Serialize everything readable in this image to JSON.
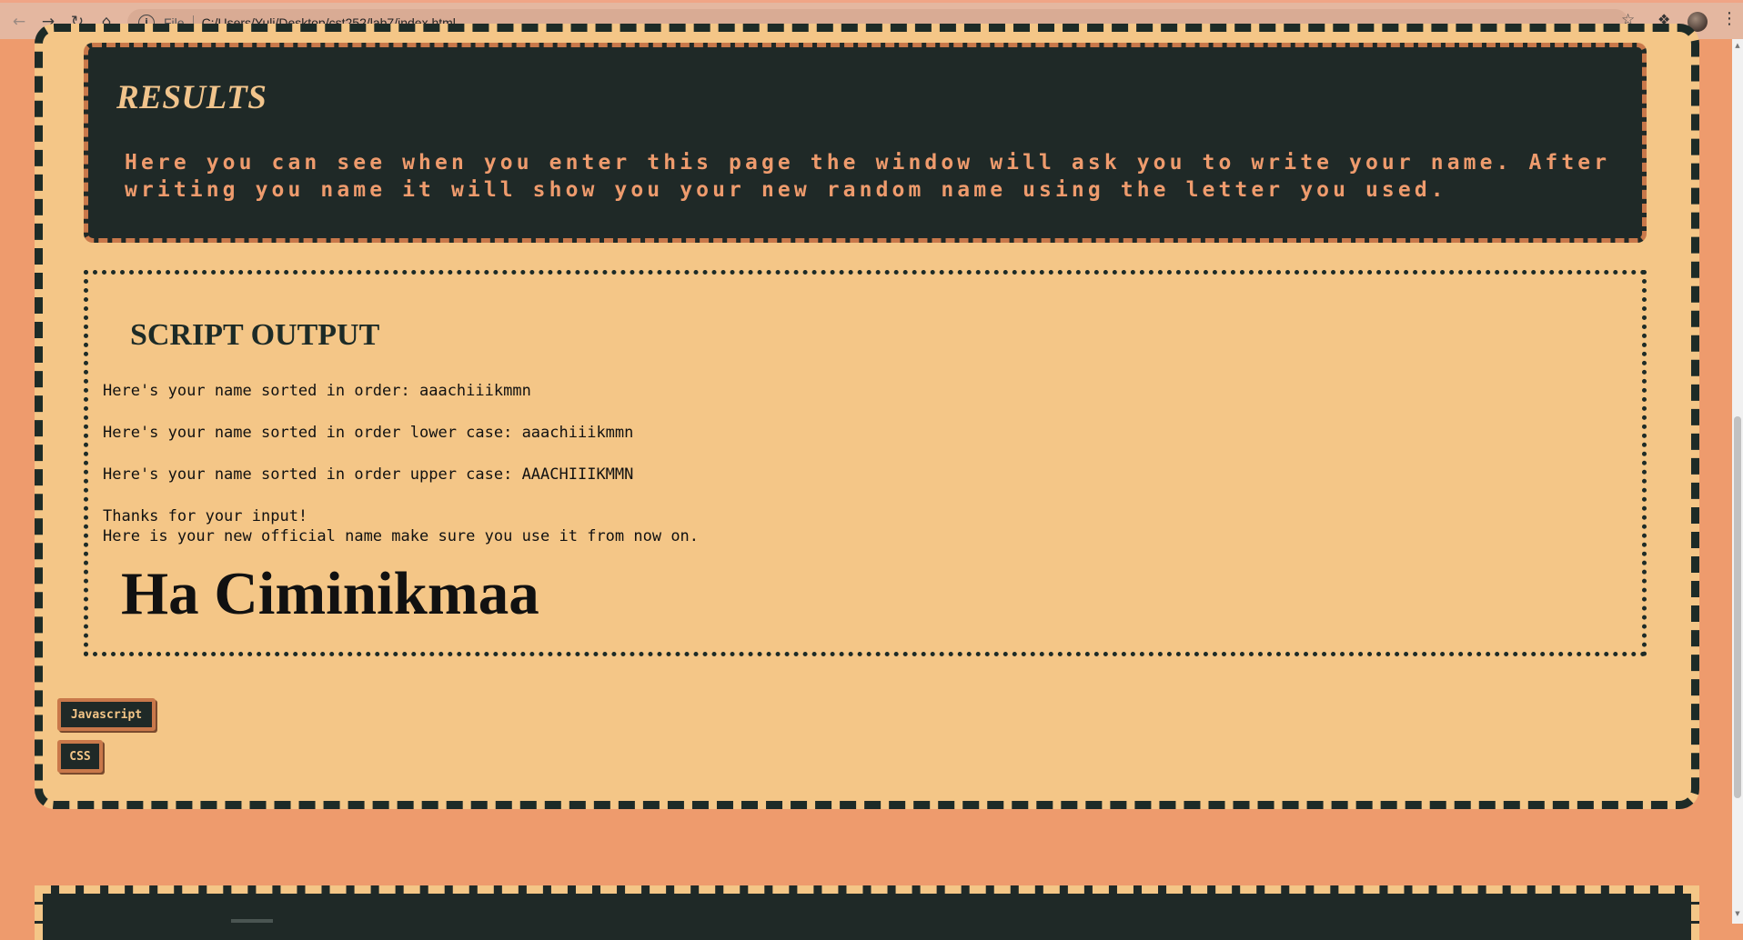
{
  "browser": {
    "scheme_label": "File",
    "url": "C:/Users/Yuli/Desktop/cst252/lab7/index.html",
    "icons": {
      "back": "back-arrow-icon",
      "forward": "forward-arrow-icon",
      "reload": "reload-icon",
      "home": "home-icon",
      "info": "info-icon",
      "bookmark": "star-icon",
      "extensions": "puzzle-icon",
      "profile": "avatar",
      "menu": "kebab-menu-icon"
    }
  },
  "results": {
    "title": "RESULTS",
    "description": "Here you can see when you enter this page the window will ask you to write your name. After writing you name it will show you your new random name using the letter you used."
  },
  "script_output": {
    "title": "SCRIPT OUTPUT",
    "sorted": "Here's your name sorted in order: aaachiiikmmn",
    "sorted_lower": "Here's your name sorted in order lower case: aaachiiikmmn",
    "sorted_upper": "Here's your name sorted in order upper case: AAACHIIIKMMN",
    "thanks": "Thanks for your input!",
    "instruction": "Here is your new official name make sure you use it from now on.",
    "new_name": "Ha Ciminikmaa"
  },
  "buttons": {
    "javascript": "Javascript",
    "css": "CSS"
  },
  "colors": {
    "page_background": "#ee9b6d",
    "card_background": "#f4c687",
    "dark": "#1f2927",
    "accent": "#c9784a"
  }
}
